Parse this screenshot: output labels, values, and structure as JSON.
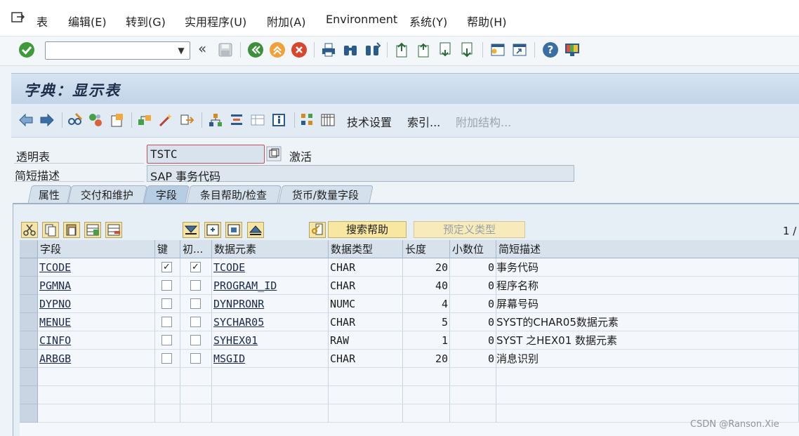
{
  "menubar": {
    "items": [
      "表",
      "编辑(E)",
      "转到(G)",
      "实用程序(U)",
      "附加(A)",
      "Environment",
      "系统(Y)",
      "帮助(H)"
    ]
  },
  "toolbar": {
    "command_value": "",
    "back_glyph": "«"
  },
  "title": "字典：显示表",
  "app_toolbar": {
    "tech_settings": "技术设置",
    "index": "索引...",
    "append_structure": "附加结构..."
  },
  "header": {
    "table_label": "透明表",
    "table_value": "TSTC",
    "status": "激活",
    "desc_label": "简短描述",
    "desc_value": "SAP 事务代码"
  },
  "tabs": [
    "属性",
    "交付和维护",
    "字段",
    "条目帮助/检查",
    "货币/数量字段"
  ],
  "active_tab": "字段",
  "table_toolbar": {
    "search_help": "搜索帮助",
    "predefined_type": "预定义类型",
    "page_counter": "1 /"
  },
  "table": {
    "columns": [
      "字段",
      "键",
      "初...",
      "数据元素",
      "数据类型",
      "长度",
      "小数位",
      "简短描述"
    ],
    "rows": [
      {
        "field": "TCODE",
        "key": true,
        "init": true,
        "element": "TCODE",
        "type": "CHAR",
        "length": "20",
        "decimals": "0",
        "desc": "事务代码"
      },
      {
        "field": "PGMNA",
        "key": false,
        "init": false,
        "element": "PROGRAM_ID",
        "type": "CHAR",
        "length": "40",
        "decimals": "0",
        "desc": "程序名称"
      },
      {
        "field": "DYPNO",
        "key": false,
        "init": false,
        "element": "DYNPRONR",
        "type": "NUMC",
        "length": "4",
        "decimals": "0",
        "desc": "屏幕号码"
      },
      {
        "field": "MENUE",
        "key": false,
        "init": false,
        "element": "SYCHAR05",
        "type": "CHAR",
        "length": "5",
        "decimals": "0",
        "desc": "SYST的CHAR05数据元素"
      },
      {
        "field": "CINFO",
        "key": false,
        "init": false,
        "element": "SYHEX01",
        "type": "RAW",
        "length": "1",
        "decimals": "0",
        "desc": "SYST 之HEX01 数据元素"
      },
      {
        "field": "ARBGB",
        "key": false,
        "init": false,
        "element": "MSGID",
        "type": "CHAR",
        "length": "20",
        "decimals": "0",
        "desc": "消息识别"
      }
    ],
    "check_glyph": "✓"
  },
  "watermark": "CSDN @Ranson.Xie",
  "colors": {
    "accent": "#1d2f4a",
    "tab_active": "#b6cde4",
    "button_yellow": "#f7e7a0"
  }
}
